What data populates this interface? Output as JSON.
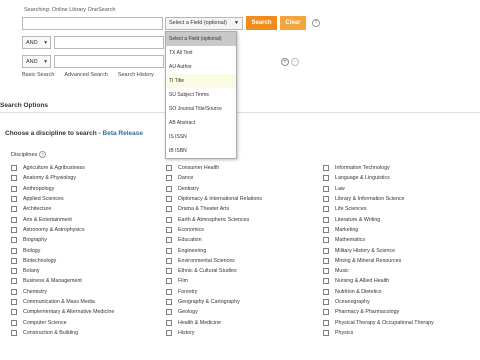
{
  "search": {
    "searching_label": "Searching: Online Library OneSearch",
    "field_select_value": "Select a Field (optional)",
    "search_button": "Search",
    "clear_button": "Clear",
    "help_symbol": "?",
    "rows": [
      {
        "operator": "AND"
      },
      {
        "operator": "AND"
      }
    ],
    "add_symbol": "+",
    "remove_symbol": "−"
  },
  "links": [
    "Basic Search",
    "Advanced Search",
    "Search History"
  ],
  "field_dropdown": {
    "options": [
      "Select a Field (optional)",
      "TX All Text",
      "AU Author",
      "TI Title",
      "SU Subject Terms",
      "SO Journal Title/Source",
      "AB Abstract",
      "IS ISSN",
      "IB ISBN"
    ]
  },
  "search_options": {
    "heading": "Search Options",
    "choose_prefix": "Choose a discipline to search - ",
    "beta_label": "Beta Release",
    "disciplines_label": "Disciplines",
    "columns": [
      [
        "Agriculture & Agribusiness",
        "Anatomy & Physiology",
        "Anthropology",
        "Applied Sciences",
        "Architecture",
        "Arts & Entertainment",
        "Astronomy & Astrophysics",
        "Biography",
        "Biology",
        "Biotechnology",
        "Botany",
        "Business & Management",
        "Chemistry",
        "Communication & Mass Media",
        "Complementary & Alternative Medicine",
        "Computer Science",
        "Construction & Building"
      ],
      [
        "Consumer Health",
        "Dance",
        "Dentistry",
        "Diplomacy & International Relations",
        "Drama & Theater Arts",
        "Earth & Atmospheric Sciences",
        "Economics",
        "Education",
        "Engineering",
        "Environmental Sciences",
        "Ethnic & Cultural Studies",
        "Film",
        "Forestry",
        "Geography & Cartography",
        "Geology",
        "Health & Medicine",
        "History"
      ],
      [
        "Information Technology",
        "Language & Linguistics",
        "Law",
        "Library & Information Science",
        "Life Sciences",
        "Literature & Writing",
        "Marketing",
        "Mathematics",
        "Military History & Science",
        "Mining & Mineral Resources",
        "Music",
        "Nursing & Allied Health",
        "Nutrition & Dietetics",
        "Oceanography",
        "Pharmacy & Pharmacology",
        "Physical Therapy & Occupational Therapy",
        "Physics"
      ]
    ]
  }
}
